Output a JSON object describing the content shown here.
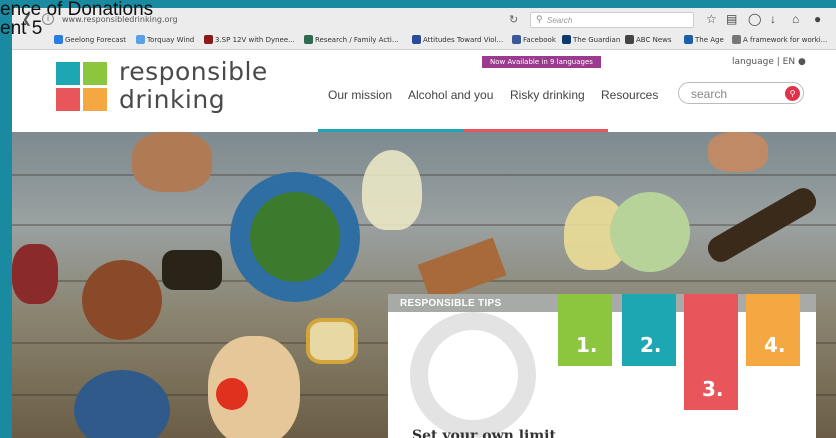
{
  "slide": {
    "title": "ence of Donations\nent 5"
  },
  "browser": {
    "url": "www.responsibledrinking.org",
    "search_placeholder": "Search",
    "bookmarks": [
      {
        "label": "Geelong Forecast",
        "color": "#2a7de1"
      },
      {
        "label": "Torquay Wind",
        "color": "#5aa0e6"
      },
      {
        "label": "3.SP 12V with Dynee...",
        "color": "#8b1a1a"
      },
      {
        "label": "Research / Family Acti...",
        "color": "#2d6a4f"
      },
      {
        "label": "Attitudes Toward Viol...",
        "color": "#2b4c9c"
      },
      {
        "label": "Facebook",
        "color": "#3b5998"
      },
      {
        "label": "The Guardian",
        "color": "#0a3a6e"
      },
      {
        "label": "ABC News",
        "color": "#444444"
      },
      {
        "label": "The Age",
        "color": "#1f5fa8"
      },
      {
        "label": "A framework for worki...",
        "color": "#777777"
      }
    ]
  },
  "site": {
    "logo_text_line1": "responsible",
    "logo_text_line2": "drinking",
    "badge": "Now Available in 9 languages",
    "language": "language | EN",
    "nav": [
      "Our mission",
      "Alcohol and you",
      "Risky drinking",
      "Resources"
    ],
    "search_placeholder": "search",
    "colors": {
      "teal": "#1ca7b3",
      "green": "#8cc63f",
      "red": "#e8565a",
      "orange": "#f5a742",
      "purple": "#9b3a8e"
    }
  },
  "tips": {
    "title": "RESPONSIBLE TIPS",
    "items": [
      "1.",
      "2.",
      "3.",
      "4."
    ],
    "heading": "Set your own limit"
  }
}
